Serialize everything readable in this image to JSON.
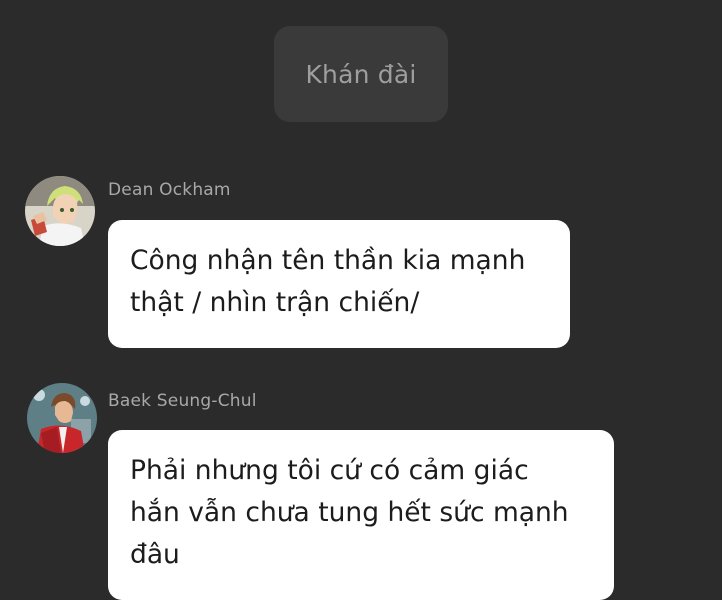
{
  "header": {
    "chip_label": "Khán đài"
  },
  "messages": [
    {
      "sender": "Dean Ockham",
      "avatar_icon": "blonde-character-avatar-icon",
      "text": "Công nhận tên thần kia mạnh\nthật / nhìn trận chiến/"
    },
    {
      "sender": "Baek Seung-Chul",
      "avatar_icon": "red-jacket-character-avatar-icon",
      "text": "Phải nhưng tôi cứ có cảm giác\nhắn vẫn chưa tung hết sức mạnh\nđâu"
    }
  ],
  "colors": {
    "background": "#2b2b2b",
    "chip": "#3a3a3a",
    "bubble": "#ffffff",
    "name_text": "#a8a8a8"
  }
}
